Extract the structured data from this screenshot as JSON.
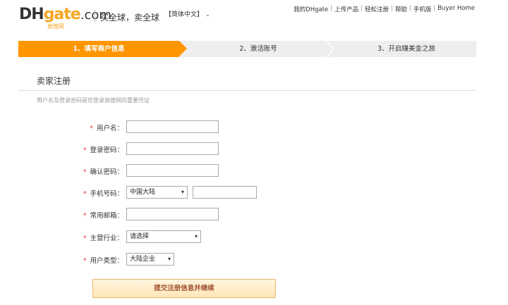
{
  "header": {
    "logo_dh": "DH",
    "logo_gate": "gate",
    "logo_com": ".com",
    "logo_sub": "敦煌网",
    "slogan": "买全球，卖全球",
    "language": "简体中文",
    "nav": [
      "我的DHgate",
      "上传产品",
      "轻松注册",
      "帮助",
      "手机版",
      "Buyer Home"
    ]
  },
  "steps": {
    "step1": "1、填写商户信息",
    "step2": "2、激活账号",
    "step3": "3、开启赚美金之旅"
  },
  "section": {
    "title": "卖家注册",
    "note": "用户名及登录密码是您登录敦煌网的重要凭证"
  },
  "form": {
    "username_label": "用户名：",
    "password_label": "登录密码：",
    "confirm_label": "确认密码：",
    "phone_label": "手机号码：",
    "phone_region": "中国大陆",
    "email_label": "常用邮箱：",
    "industry_label": "主营行业：",
    "industry_value": "请选择",
    "usertype_label": "用户类型：",
    "usertype_value": "大陆企业",
    "required_mark": "*"
  },
  "submit_label": "提交注册信息并继续",
  "colors": {
    "accent": "#ff9600",
    "required": "#e4393c"
  }
}
